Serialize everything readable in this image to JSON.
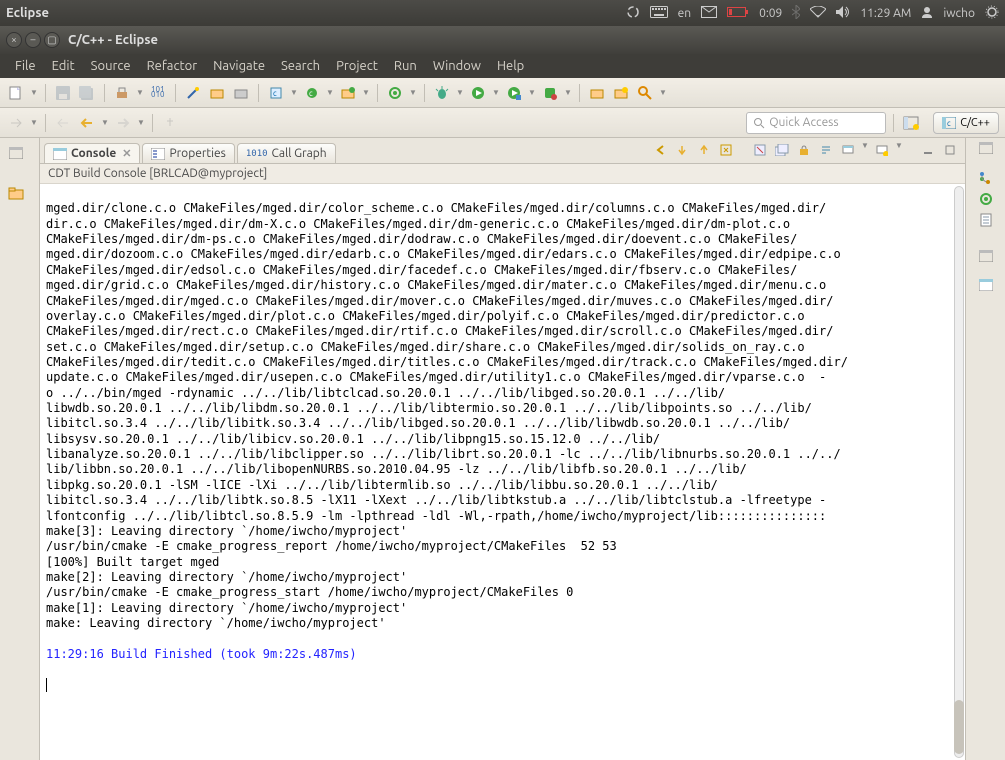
{
  "top": {
    "title": "Eclipse",
    "lang": "en",
    "time1": "0:09",
    "time2": "11:29 AM",
    "user": "iwcho"
  },
  "win": {
    "title": "C/C++ - Eclipse"
  },
  "menu": [
    "File",
    "Edit",
    "Source",
    "Refactor",
    "Navigate",
    "Search",
    "Project",
    "Run",
    "Window",
    "Help"
  ],
  "quick_placeholder": "Quick Access",
  "perspective": "C/C++",
  "tabs": {
    "console": "Console",
    "properties": "Properties",
    "callgraph": "Call Graph"
  },
  "console_title": "CDT Build Console [BRLCAD@myproject]",
  "console_lines": [
    "mged.dir/clone.c.o CMakeFiles/mged.dir/color_scheme.c.o CMakeFiles/mged.dir/columns.c.o CMakeFiles/mged.dir/",
    "dir.c.o CMakeFiles/mged.dir/dm-X.c.o CMakeFiles/mged.dir/dm-generic.c.o CMakeFiles/mged.dir/dm-plot.c.o ",
    "CMakeFiles/mged.dir/dm-ps.c.o CMakeFiles/mged.dir/dodraw.c.o CMakeFiles/mged.dir/doevent.c.o CMakeFiles/",
    "mged.dir/dozoom.c.o CMakeFiles/mged.dir/edarb.c.o CMakeFiles/mged.dir/edars.c.o CMakeFiles/mged.dir/edpipe.c.o ",
    "CMakeFiles/mged.dir/edsol.c.o CMakeFiles/mged.dir/facedef.c.o CMakeFiles/mged.dir/fbserv.c.o CMakeFiles/",
    "mged.dir/grid.c.o CMakeFiles/mged.dir/history.c.o CMakeFiles/mged.dir/mater.c.o CMakeFiles/mged.dir/menu.c.o ",
    "CMakeFiles/mged.dir/mged.c.o CMakeFiles/mged.dir/mover.c.o CMakeFiles/mged.dir/muves.c.o CMakeFiles/mged.dir/",
    "overlay.c.o CMakeFiles/mged.dir/plot.c.o CMakeFiles/mged.dir/polyif.c.o CMakeFiles/mged.dir/predictor.c.o ",
    "CMakeFiles/mged.dir/rect.c.o CMakeFiles/mged.dir/rtif.c.o CMakeFiles/mged.dir/scroll.c.o CMakeFiles/mged.dir/",
    "set.c.o CMakeFiles/mged.dir/setup.c.o CMakeFiles/mged.dir/share.c.o CMakeFiles/mged.dir/solids_on_ray.c.o ",
    "CMakeFiles/mged.dir/tedit.c.o CMakeFiles/mged.dir/titles.c.o CMakeFiles/mged.dir/track.c.o CMakeFiles/mged.dir/",
    "update.c.o CMakeFiles/mged.dir/usepen.c.o CMakeFiles/mged.dir/utility1.c.o CMakeFiles/mged.dir/vparse.c.o  -",
    "o ../../bin/mged -rdynamic ../../lib/libtclcad.so.20.0.1 ../../lib/libged.so.20.0.1 ../../lib/",
    "libwdb.so.20.0.1 ../../lib/libdm.so.20.0.1 ../../lib/libtermio.so.20.0.1 ../../lib/libpoints.so ../../lib/",
    "libitcl.so.3.4 ../../lib/libitk.so.3.4 ../../lib/libged.so.20.0.1 ../../lib/libwdb.so.20.0.1 ../../lib/",
    "libsysv.so.20.0.1 ../../lib/libicv.so.20.0.1 ../../lib/libpng15.so.15.12.0 ../../lib/",
    "libanalyze.so.20.0.1 ../../lib/libclipper.so ../../lib/librt.so.20.0.1 -lc ../../lib/libnurbs.so.20.0.1 ../../",
    "lib/libbn.so.20.0.1 ../../lib/libopenNURBS.so.2010.04.95 -lz ../../lib/libfb.so.20.0.1 ../../lib/",
    "libpkg.so.20.0.1 -lSM -lICE -lXi ../../lib/libtermlib.so ../../lib/libbu.so.20.0.1 ../../lib/",
    "libitcl.so.3.4 ../../lib/libtk.so.8.5 -lX11 -lXext ../../lib/libtkstub.a ../../lib/libtclstub.a -lfreetype -",
    "lfontconfig ../../lib/libtcl.so.8.5.9 -lm -lpthread -ldl -Wl,-rpath,/home/iwcho/myproject/lib::::::::::::::: ",
    "make[3]: Leaving directory `/home/iwcho/myproject'",
    "/usr/bin/cmake -E cmake_progress_report /home/iwcho/myproject/CMakeFiles  52 53",
    "[100%] Built target mged",
    "make[2]: Leaving directory `/home/iwcho/myproject'",
    "/usr/bin/cmake -E cmake_progress_start /home/iwcho/myproject/CMakeFiles 0",
    "make[1]: Leaving directory `/home/iwcho/myproject'",
    "make: Leaving directory `/home/iwcho/myproject'"
  ],
  "finish_line": "11:29:16 Build Finished (took 9m:22s.487ms)"
}
